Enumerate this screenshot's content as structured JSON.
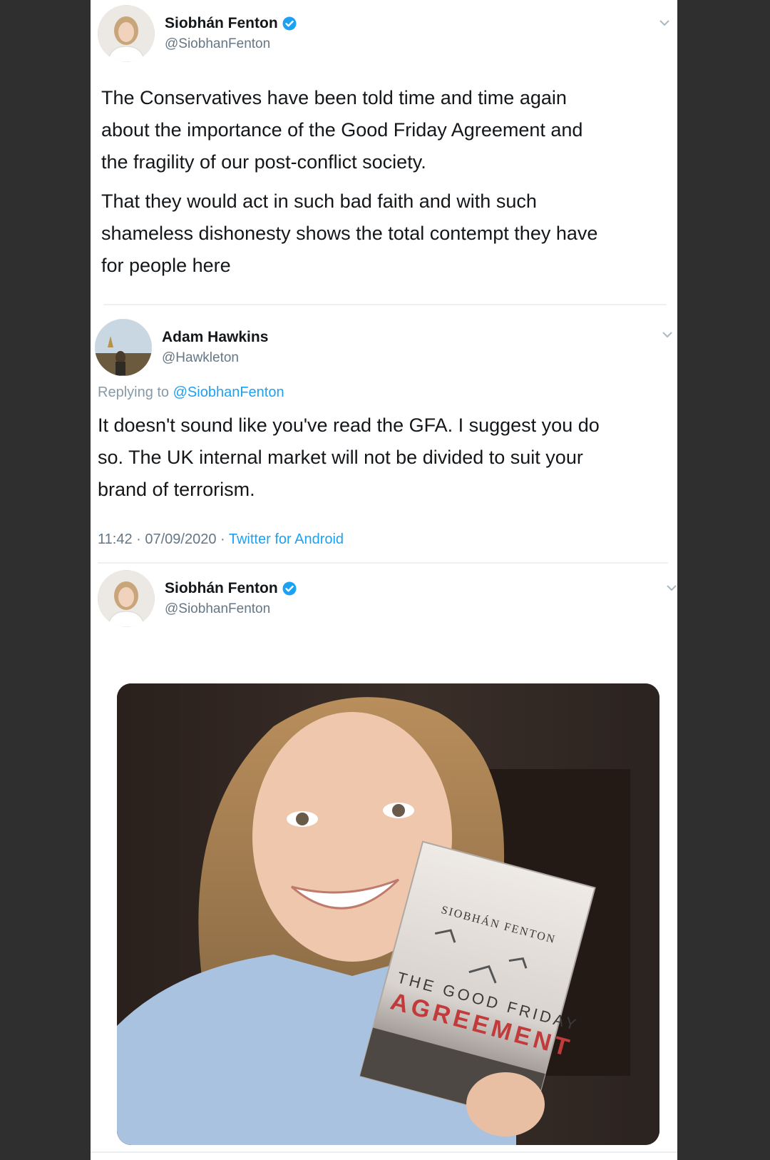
{
  "tweet1": {
    "author": {
      "display_name": "Siobhán Fenton",
      "handle": "@SiobhanFenton",
      "verified": true
    },
    "paragraphs": [
      [
        "The Conservatives have been told time and time again",
        "about the importance of the Good Friday Agreement and",
        "the fragility of our post-conflict society."
      ],
      [
        "That they would act in such bad faith and with such",
        "shameless dishonesty shows the total contempt they have",
        "for people here"
      ]
    ]
  },
  "quoted_tweet": {
    "author": {
      "display_name": "Adam Hawkins",
      "handle": "@Hawkleton"
    },
    "replying_to_label": "Replying to",
    "replying_to_handle": "@SiobhanFenton",
    "lines": [
      "It doesn't sound like you've read the GFA. I suggest you do",
      "so. The UK internal market will not be divided to suit your",
      "brand of terrorism."
    ],
    "timestamp": "11:42 · 07/09/2020 ·",
    "client": "Twitter for Android"
  },
  "tweet2": {
    "author": {
      "display_name": "Siobhán Fenton",
      "handle": "@SiobhanFenton",
      "verified": true
    },
    "photo": {
      "book_author": "SIOBHÁN FENTON",
      "book_title_line1": "THE GOOD FRIDAY",
      "book_title_line2": "AGREEMENT"
    }
  },
  "colors": {
    "verified_blue": "#1da1f2",
    "link_blue": "#1da1f2",
    "text_primary": "#14171a",
    "text_secondary": "#657786",
    "outer_background": "#2f2f2f"
  },
  "icons": {
    "verified": "verified-badge-icon",
    "menu": "chevron-down-icon"
  }
}
